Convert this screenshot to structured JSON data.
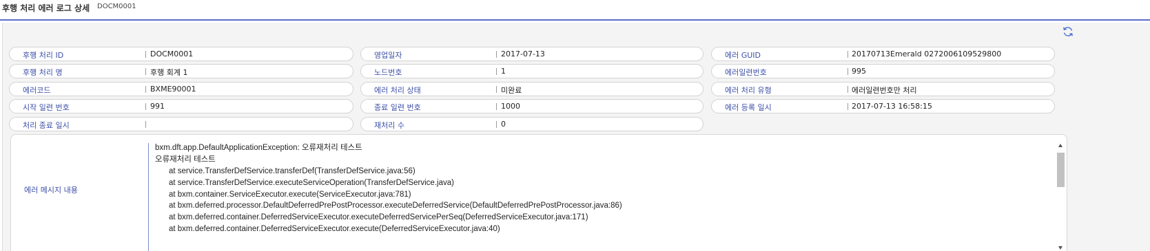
{
  "header": {
    "title": "후행 처리 에러 로그 상세",
    "subtitle": "DOCM0001"
  },
  "toolbar": {
    "refresh_icon": "refresh-icon"
  },
  "colors": {
    "accent": "#5a6bc9",
    "label": "#3c4fa8",
    "panel_bg": "#f4f4f4"
  },
  "fields": {
    "deferred_id": {
      "label": "후행 처리 ID",
      "value": "DOCM0001"
    },
    "business_date": {
      "label": "영업일자",
      "value": "2017-07-13"
    },
    "error_guid": {
      "label": "에러 GUID",
      "value": "20170713Emerald 0272006109529800"
    },
    "deferred_name": {
      "label": "후행 처리 명",
      "value": "후행 회계 1"
    },
    "node_no": {
      "label": "노드번호",
      "value": "1"
    },
    "error_serial": {
      "label": "에러일련번호",
      "value": "995"
    },
    "error_code": {
      "label": "에러코드",
      "value": "BXME90001"
    },
    "error_status": {
      "label": "에러 처리 상태",
      "value": "미완료"
    },
    "error_type": {
      "label": "에러 처리 유형",
      "value": "에러일련번호만 처리"
    },
    "start_serial": {
      "label": "시작 일련 번호",
      "value": "991"
    },
    "end_serial": {
      "label": "종료 일련 번호",
      "value": "1000"
    },
    "error_reg_time": {
      "label": "에러 등록 일시",
      "value": "2017-07-13 16:58:15"
    },
    "finish_time": {
      "label": "처리 종료 일시",
      "value": ""
    },
    "retry_count": {
      "label": "재처리 수",
      "value": "0"
    }
  },
  "message": {
    "label": "에러 메시지 내용",
    "lines": [
      "bxm.dft.app.DefaultApplicationException: 오류재처리 테스트",
      "오류재처리 테스트",
      "at service.TransferDefService.transferDef(TransferDefService.java:56)",
      "at service.TransferDefService.executeServiceOperation(TransferDefService.java)",
      "at bxm.container.ServiceExecutor.execute(ServiceExecutor.java:781)",
      "at bxm.deferred.processor.DefaultDeferredPrePostProcessor.executeDeferredService(DefaultDeferredPrePostProcessor.java:86)",
      "at bxm.deferred.container.DeferredServiceExecutor.executeDeferredServicePerSeq(DeferredServiceExecutor.java:171)",
      "at bxm.deferred.container.DeferredServiceExecutor.execute(DeferredServiceExecutor.java:40)"
    ]
  }
}
